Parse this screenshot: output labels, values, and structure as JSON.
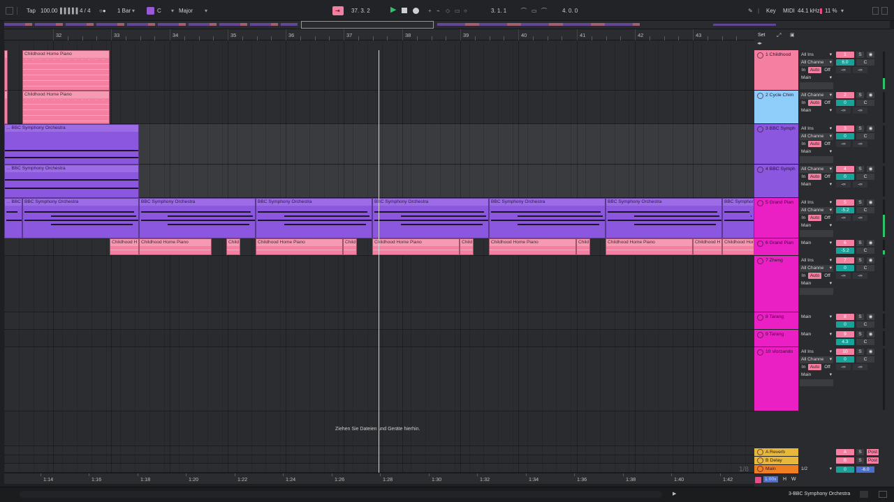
{
  "colors": {
    "pink": "#f47fa1",
    "light_blue": "#8fcdfb",
    "purple": "#8a57de",
    "magenta": "#ea1fc4",
    "yellow": "#e7b83a",
    "orange": "#f07f22",
    "teal": "#17a39a"
  },
  "topbar": {
    "tap": "Tap",
    "tempo": "100.00",
    "metronome_icon": "tempo-nudge-icon",
    "time_signature": "4 / 4",
    "quantize_dot": "○●",
    "quantize": "1 Bar",
    "key": "C",
    "scale": "Major",
    "position": "37.  3.  2",
    "loop_start": "3.  1.  1",
    "loop_length": "4.  0.  0",
    "key_mode": "Key",
    "midi_mode": "MIDI",
    "sample_rate": "44.1 kHz",
    "cpu": "11 %"
  },
  "ruler": {
    "bars": [
      "32",
      "33",
      "34",
      "35",
      "36",
      "37",
      "38",
      "39",
      "40",
      "41",
      "42",
      "43"
    ],
    "set_label": "Set"
  },
  "arrangement": {
    "drop_hint": "Ziehen Sie Dateien und Geräte hierhin.",
    "quantization_hint": "1/8",
    "clip_labels": {
      "piano": "Childhood Home Piano",
      "piano_short": "Childhood H",
      "piano_tiny": "Child",
      "bbc": "BBC Symphony Orchestra",
      "bbc_prefix": "... BBC Symphony Orchestra",
      "bbc_short": "BBC Symphony",
      "bbc_tiny": "... BBC"
    }
  },
  "time_ruler": [
    "1:14",
    "1:16",
    "1:18",
    "1:20",
    "1:22",
    "1:24",
    "1:26",
    "1:28",
    "1:30",
    "1:32",
    "1:34",
    "1:36",
    "1:38",
    "1:40",
    "1:42"
  ],
  "tracks": [
    {
      "name": "1 Childhood",
      "num": "1",
      "input": "All Ins",
      "channel": "All Channe",
      "vol": "6.0",
      "pan": "C",
      "out": "Main",
      "inf1": "-∞",
      "inf2": "-∞"
    },
    {
      "name": "2 Cycle Chim",
      "num": "2",
      "input": "",
      "channel": "All Channe",
      "vol": "0",
      "pan": "C",
      "out": "Main",
      "inf1": "-∞",
      "inf2": "-∞"
    },
    {
      "name": "3 BBC Symph",
      "num": "3",
      "input": "All Ins",
      "channel": "All Channe",
      "vol": "0",
      "pan": "C",
      "out": "Main",
      "inf1": "-∞",
      "inf2": "-∞"
    },
    {
      "name": "4 BBC Symph",
      "num": "4",
      "input": "",
      "channel": "All Channe",
      "vol": "0",
      "pan": "C",
      "out": "Main",
      "inf1": "-∞",
      "inf2": "-∞"
    },
    {
      "name": "5 Grand Pian",
      "num": "5",
      "input": "All Ins",
      "channel": "All Channe",
      "vol": "-5.2",
      "pan": "C",
      "out": "Main",
      "inf1": "-∞",
      "inf2": "-∞"
    },
    {
      "name": "6 Grand Pian",
      "num": "6",
      "input": "",
      "channel": "",
      "vol": "-5.2",
      "pan": "C",
      "out": "Main",
      "inf1": "",
      "inf2": ""
    },
    {
      "name": "7 Zheng",
      "num": "7",
      "input": "All Ins",
      "channel": "All Channe",
      "vol": "0",
      "pan": "C",
      "out": "Main",
      "inf1": "-∞",
      "inf2": "-∞"
    },
    {
      "name": "8 Tarang",
      "num": "8",
      "input": "",
      "channel": "",
      "vol": "0",
      "pan": "C",
      "out": "Main",
      "inf1": "",
      "inf2": ""
    },
    {
      "name": "9 Tarang",
      "num": "9",
      "input": "",
      "channel": "",
      "vol": "4.3",
      "pan": "C",
      "out": "Main",
      "inf1": "",
      "inf2": ""
    },
    {
      "name": "10 sforzando",
      "num": "10",
      "input": "All Ins",
      "channel": "All Channe",
      "vol": "0",
      "pan": "C",
      "out": "Main",
      "inf1": "-∞",
      "inf2": "-∞"
    }
  ],
  "monitor": {
    "in": "In",
    "auto": "Auto",
    "off": "Off",
    "solo": "S"
  },
  "returns": [
    {
      "name": "A Reverb",
      "num": "A",
      "post": "Post"
    },
    {
      "name": "B Delay",
      "num": "B",
      "post": "Post"
    }
  ],
  "main": {
    "name": "Main",
    "cue": "1/2",
    "vol": "0",
    "pan": "-6.0"
  },
  "bottom": {
    "zoom": "1.00x",
    "h": "H",
    "w": "W",
    "selected_track": "3-BBC Symphony Orchestra"
  }
}
